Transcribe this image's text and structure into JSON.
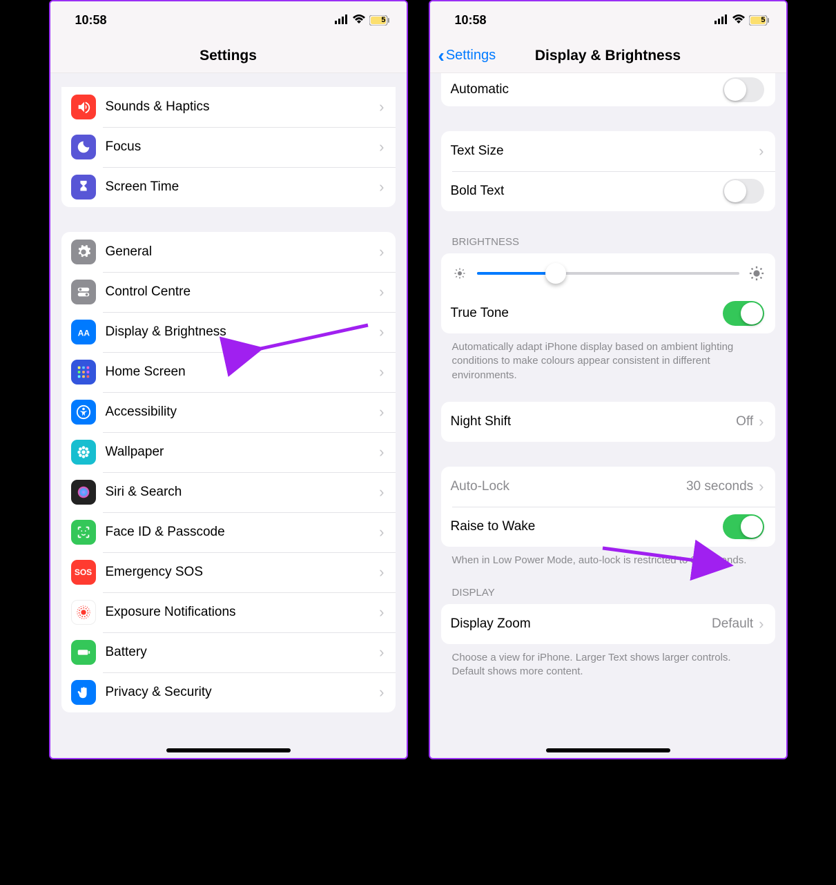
{
  "status": {
    "time": "10:58",
    "battery": "5"
  },
  "left": {
    "title": "Settings",
    "items": [
      {
        "label": "Sounds & Haptics",
        "iconColor": "#ff3b30",
        "iconName": "speaker-icon"
      },
      {
        "label": "Focus",
        "iconColor": "#5856d6",
        "iconName": "moon-icon"
      },
      {
        "label": "Screen Time",
        "iconColor": "#5856d6",
        "iconName": "hourglass-icon"
      }
    ],
    "items2": [
      {
        "label": "General",
        "iconColor": "#8e8e93",
        "iconName": "gear-icon"
      },
      {
        "label": "Control Centre",
        "iconColor": "#8e8e93",
        "iconName": "switches-icon"
      },
      {
        "label": "Display & Brightness",
        "iconColor": "#007aff",
        "iconName": "aa-icon"
      },
      {
        "label": "Home Screen",
        "iconColor": "#3355dd",
        "iconName": "grid-icon"
      },
      {
        "label": "Accessibility",
        "iconColor": "#007aff",
        "iconName": "accessibility-icon"
      },
      {
        "label": "Wallpaper",
        "iconColor": "#17bed0",
        "iconName": "flower-icon"
      },
      {
        "label": "Siri & Search",
        "iconColor": "#222222",
        "iconName": "siri-icon"
      },
      {
        "label": "Face ID & Passcode",
        "iconColor": "#34c759",
        "iconName": "faceid-icon"
      },
      {
        "label": "Emergency SOS",
        "iconColor": "#ff3b30",
        "iconName": "sos-icon",
        "iconText": "SOS"
      },
      {
        "label": "Exposure Notifications",
        "iconColor": "#ffffff",
        "iconName": "exposure-icon"
      },
      {
        "label": "Battery",
        "iconColor": "#34c759",
        "iconName": "battery-icon"
      },
      {
        "label": "Privacy & Security",
        "iconColor": "#007aff",
        "iconName": "hand-icon"
      }
    ]
  },
  "right": {
    "back": "Settings",
    "title": "Display & Brightness",
    "automatic": {
      "label": "Automatic",
      "on": false
    },
    "textSize": {
      "label": "Text Size"
    },
    "boldText": {
      "label": "Bold Text",
      "on": false
    },
    "brightnessHeader": "BRIGHTNESS",
    "brightnessPercent": 30,
    "trueTone": {
      "label": "True Tone",
      "on": true
    },
    "trueToneFooter": "Automatically adapt iPhone display based on ambient lighting conditions to make colours appear consistent in different environments.",
    "nightShift": {
      "label": "Night Shift",
      "value": "Off"
    },
    "autoLock": {
      "label": "Auto-Lock",
      "value": "30 seconds"
    },
    "raiseToWake": {
      "label": "Raise to Wake",
      "on": true
    },
    "lowPowerFooter": "When in Low Power Mode, auto-lock is restricted to 30 seconds.",
    "displayHeader": "DISPLAY",
    "displayZoom": {
      "label": "Display Zoom",
      "value": "Default"
    },
    "displayZoomFooter": "Choose a view for iPhone. Larger Text shows larger controls. Default shows more content."
  }
}
